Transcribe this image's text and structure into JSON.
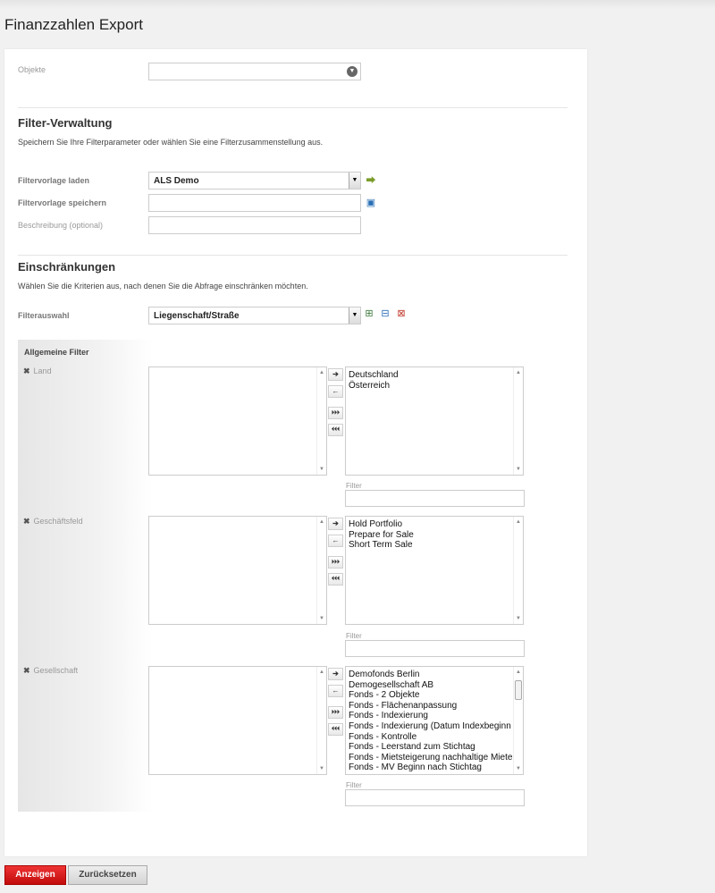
{
  "page_title": "Finanzzahlen Export",
  "objekte": {
    "label": "Objekte",
    "value": ""
  },
  "filter_verwaltung": {
    "title": "Filter-Verwaltung",
    "description": "Speichern Sie Ihre Filterparameter oder wählen Sie eine Filterzusammenstellung aus.",
    "load_label": "Filtervorlage laden",
    "load_value": "ALS Demo",
    "save_label": "Filtervorlage speichern",
    "save_value": "",
    "desc_label": "Beschreibung (optional)",
    "desc_value": ""
  },
  "einschraenkungen": {
    "title": "Einschränkungen",
    "description": "Wählen Sie die Kriterien aus, nach denen Sie die Abfrage einschränken möchten.",
    "filterauswahl_label": "Filterauswahl",
    "filterauswahl_value": "Liegenschaft/Straße"
  },
  "allgemeine_filter": {
    "title": "Allgemeine Filter",
    "filter_label": "Filter",
    "groups": [
      {
        "label": "Land",
        "available": [],
        "selected": [
          "Deutschland",
          "Österreich"
        ]
      },
      {
        "label": "Geschäftsfeld",
        "available": [],
        "selected": [
          "Hold Portfolio",
          "Prepare for Sale",
          "Short Term Sale"
        ]
      },
      {
        "label": "Gesellschaft",
        "available": [],
        "selected": [
          "Demofonds Berlin",
          "Demogesellschaft AB",
          "Fonds - 2 Objekte",
          "Fonds - Flächenanpassung",
          "Fonds - Indexierung",
          "Fonds - Indexierung (Datum Indexbeginn fehlt)",
          "Fonds - Kontrolle",
          "Fonds - Leerstand zum Stichtag",
          "Fonds - Mietsteigerung nachhaltige Miete",
          "Fonds - MV Beginn nach Stichtag"
        ]
      }
    ]
  },
  "move_buttons": {
    "add": "➔",
    "remove": "←",
    "add_all": "⏵⏵⏵",
    "remove_all": "⏴⏴⏴"
  },
  "buttons": {
    "show": "Anzeigen",
    "reset": "Zurücksetzen"
  }
}
